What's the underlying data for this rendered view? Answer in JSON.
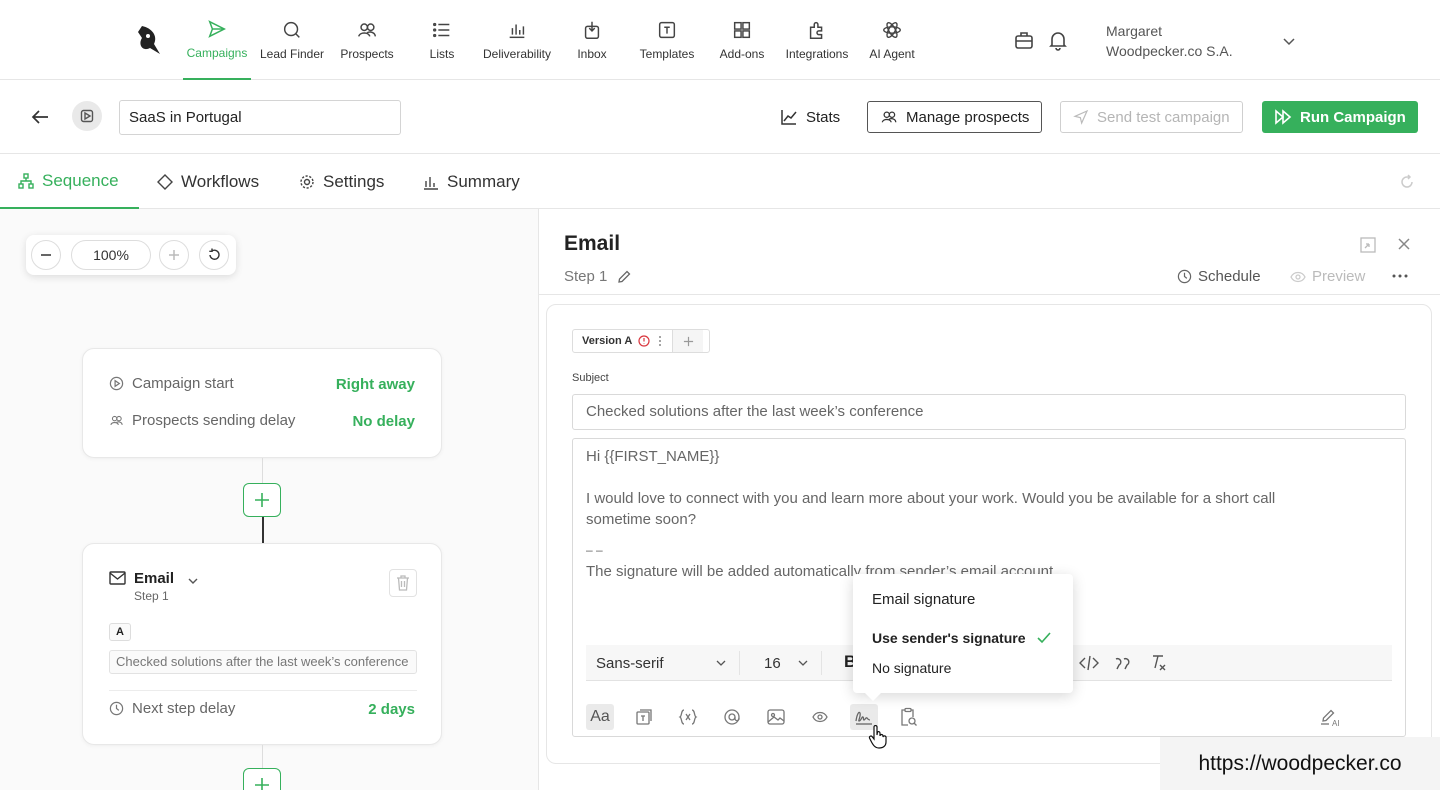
{
  "nav": {
    "items": [
      {
        "label": "Campaigns",
        "icon": "send-icon"
      },
      {
        "label": "Lead Finder",
        "icon": "search-icon"
      },
      {
        "label": "Prospects",
        "icon": "users-icon"
      },
      {
        "label": "Lists",
        "icon": "list-icon"
      },
      {
        "label": "Deliverability",
        "icon": "bar-chart-icon"
      },
      {
        "label": "Inbox",
        "icon": "inbox-icon"
      },
      {
        "label": "Templates",
        "icon": "template-icon"
      },
      {
        "label": "Add-ons",
        "icon": "grid-icon"
      },
      {
        "label": "Integrations",
        "icon": "puzzle-icon"
      },
      {
        "label": "AI Agent",
        "icon": "atom-icon"
      }
    ],
    "user_name": "Margaret",
    "user_company": "Woodpecker.co S.A."
  },
  "campaign": {
    "name": "SaaS in Portugal",
    "stats_label": "Stats",
    "manage_label": "Manage prospects",
    "test_label": "Send test campaign",
    "run_label": "Run Campaign"
  },
  "tabs": [
    "Sequence",
    "Workflows",
    "Settings",
    "Summary"
  ],
  "canvas": {
    "zoom": "100%",
    "start_card": {
      "start_label": "Campaign start",
      "start_value": "Right away",
      "delay_label": "Prospects sending delay",
      "delay_value": "No delay"
    },
    "email_card": {
      "title": "Email",
      "step": "Step 1",
      "version": "A",
      "subject": "Checked solutions after the last week’s conference",
      "next_label": "Next step delay",
      "next_value": "2 days"
    }
  },
  "panel": {
    "title": "Email",
    "step": "Step 1",
    "schedule": "Schedule",
    "preview": "Preview",
    "version_tab": "Version A",
    "subject_label": "Subject",
    "subject_value": "Checked solutions after the last week’s conference",
    "body_lines": [
      "Hi {{FIRST_NAME}}",
      "I would love to connect with you and learn more about your work. Would you be available for a short call",
      "sometime soon?",
      "– –",
      "The signature will be added automatically from sender’s email account."
    ],
    "font_family": "Sans-serif",
    "font_size": "16"
  },
  "signature_menu": {
    "title": "Email signature",
    "options": [
      "Use sender's signature",
      "No signature"
    ],
    "selected": "Use sender's signature"
  },
  "watermark": "https://woodpecker.co",
  "colors": {
    "accent": "#36b05c"
  }
}
